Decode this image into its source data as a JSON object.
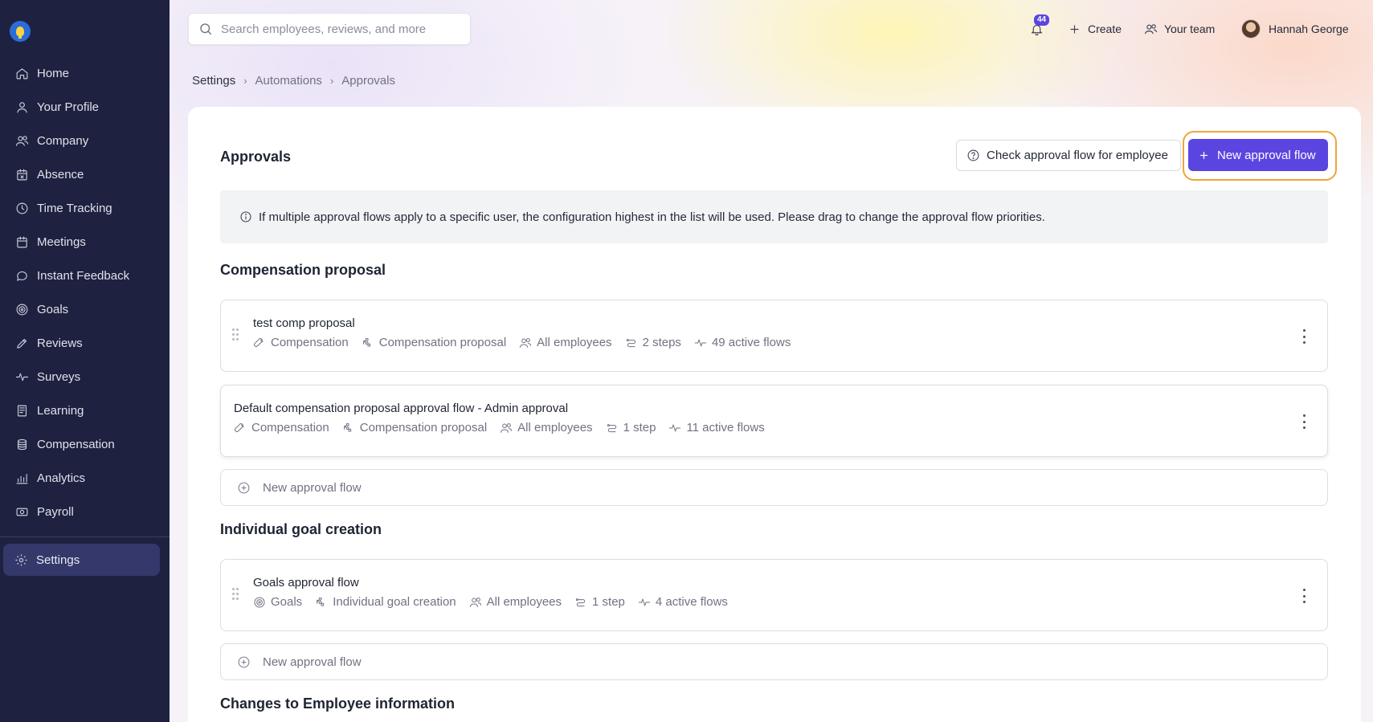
{
  "search": {
    "placeholder": "Search employees, reviews, and more"
  },
  "topbar": {
    "notification_count": "44",
    "create_label": "Create",
    "team_label": "Your team",
    "user_name": "Hannah George"
  },
  "sidebar": {
    "items": [
      {
        "label": "Home",
        "icon": "home-icon"
      },
      {
        "label": "Your Profile",
        "icon": "user-icon"
      },
      {
        "label": "Company",
        "icon": "users-icon"
      },
      {
        "label": "Absence",
        "icon": "calendar-x-icon"
      },
      {
        "label": "Time Tracking",
        "icon": "clock-icon"
      },
      {
        "label": "Meetings",
        "icon": "calendar-icon"
      },
      {
        "label": "Instant Feedback",
        "icon": "chat-icon"
      },
      {
        "label": "Goals",
        "icon": "target-icon"
      },
      {
        "label": "Reviews",
        "icon": "pen-icon"
      },
      {
        "label": "Surveys",
        "icon": "pulse-icon"
      },
      {
        "label": "Learning",
        "icon": "book-icon"
      },
      {
        "label": "Compensation",
        "icon": "coins-icon"
      },
      {
        "label": "Analytics",
        "icon": "chart-icon"
      },
      {
        "label": "Payroll",
        "icon": "money-icon"
      }
    ],
    "settings_label": "Settings"
  },
  "breadcrumb": [
    "Settings",
    "Automations",
    "Approvals"
  ],
  "page": {
    "title": "Approvals",
    "check_button": "Check approval flow for employee",
    "new_button": "New approval flow",
    "info_text": "If multiple approval flows apply to a specific user, the configuration highest in the list will be used. Please drag to change the approval flow priorities."
  },
  "sections": [
    {
      "title": "Compensation proposal",
      "flows": [
        {
          "name": "test comp proposal",
          "module": "Compensation",
          "type": "Compensation proposal",
          "audience": "All employees",
          "steps": "2 steps",
          "active": "49 active flows"
        },
        {
          "name": "Default compensation proposal approval flow - Admin approval",
          "module": "Compensation",
          "type": "Compensation proposal",
          "audience": "All employees",
          "steps": "1 step",
          "active": "11 active flows"
        }
      ],
      "add_label": "New approval flow"
    },
    {
      "title": "Individual goal creation",
      "flows": [
        {
          "name": "Goals approval flow",
          "module": "Goals",
          "type": "Individual goal creation",
          "audience": "All employees",
          "steps": "1 step",
          "active": "4 active flows"
        }
      ],
      "add_label": "New approval flow"
    },
    {
      "title": "Changes to Employee information"
    }
  ],
  "colors": {
    "sidebar_bg": "#1e2240",
    "accent": "#5b45e0",
    "highlight": "#f0a43a"
  }
}
